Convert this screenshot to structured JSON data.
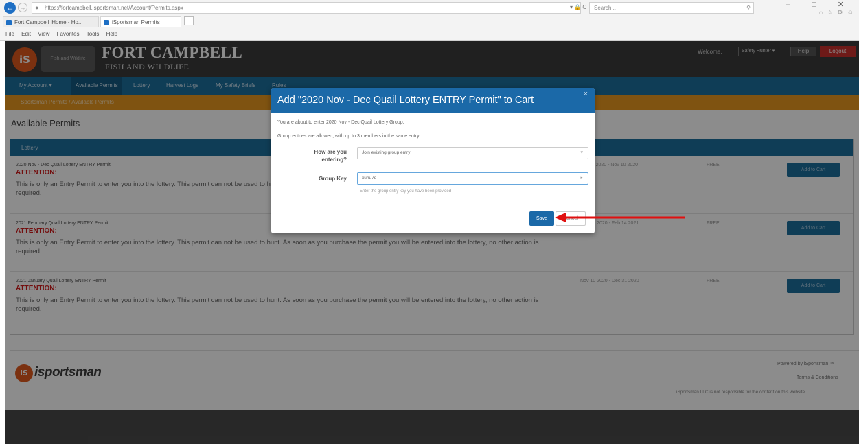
{
  "browser": {
    "url": "https://fortcampbell.isportsman.net/Account/Permits.aspx",
    "url_controls": "▾ 🔒 C",
    "search_placeholder": "Search...",
    "window_controls": "– □ ✕",
    "toolbar_icons": "⌂ ☆ ⚙ ☺",
    "tabs": [
      {
        "label": "Fort Campbell iHome - Ho..."
      },
      {
        "label": "iSportsman Permits"
      }
    ],
    "menu": [
      "File",
      "Edit",
      "View",
      "Favorites",
      "Tools",
      "Help"
    ]
  },
  "header": {
    "logo_text": "iS",
    "seal_text": "Fish and Wildlife",
    "title": "FORT CAMPBELL",
    "subtitle": "FISH AND WILDLIFE",
    "welcome": "Welcome,",
    "user_name": "Safety Hunter ▾",
    "help": "Help",
    "logout": "Logout"
  },
  "nav": {
    "items": [
      "My Account ▾",
      "Available Permits",
      "Lottery",
      "Harvest Logs",
      "My Safety Briefs",
      "Rules"
    ]
  },
  "breadcrumb": "Sportsman Permits  /  Available Permits",
  "main": {
    "title": "Available Permits",
    "panel_title": "Lottery",
    "permits": [
      {
        "name": "2020 Nov - Dec Quail Lottery ENTRY Permit",
        "attention": "ATTENTION:",
        "description": "This is only an Entry Permit to enter you into the lottery. This permit can not be used to hunt. As soon as you purchase the permit you will be entered into the lottery, no other action is required.",
        "dates": "Oct 14 2020 - Nov 10 2020",
        "price": "FREE",
        "button": "Add to Cart"
      },
      {
        "name": "2021 February Quail Lottery ENTRY Permit",
        "attention": "ATTENTION:",
        "description": "This is only an Entry Permit to enter you into the lottery. This permit can not be used to hunt. As soon as you purchase the permit you will be entered into the lottery, no other action is required.",
        "dates": "Dec 14 2020 - Feb 14 2021",
        "price": "FREE",
        "button": "Add to Cart"
      },
      {
        "name": "2021 January Quail Lottery ENTRY Permit",
        "attention": "ATTENTION:",
        "description": "This is only an Entry Permit to enter you into the lottery. This permit can not be used to hunt. As soon as you purchase the permit you will be entered into the lottery, no other action is required.",
        "dates": "Nov 10 2020 - Dec 31 2020",
        "price": "FREE",
        "button": "Add to Cart"
      }
    ]
  },
  "footer": {
    "logo_text": "iS",
    "brand": "isportsman",
    "link1": "Powered by iSportsman ™",
    "link2": "Terms & Conditions",
    "disclaimer": "iSportsman LLC is not responsible for the content on this website."
  },
  "modal": {
    "title": "Add \"2020 Nov - Dec Quail Lottery ENTRY Permit\" to Cart",
    "close": "×",
    "line1": "You are about to enter 2020 Nov - Dec Quail Lottery Group.",
    "line2": "Group entries are allowed, with up to 3 members in the same entry.",
    "entering_label": "How are you entering?",
    "entering_value": "Join existing group entry",
    "group_key_label": "Group Key",
    "group_key_value": "xuhu7d",
    "group_key_help": "Enter the group entry key you have been provided",
    "save": "Save",
    "cancel": "Cancel"
  },
  "colors": {
    "brand_blue": "#1d6f9d",
    "modal_blue": "#1b69a8",
    "accent_orange": "#e89820",
    "attention_red": "#d11a1a",
    "arrow_red": "#e01010"
  }
}
